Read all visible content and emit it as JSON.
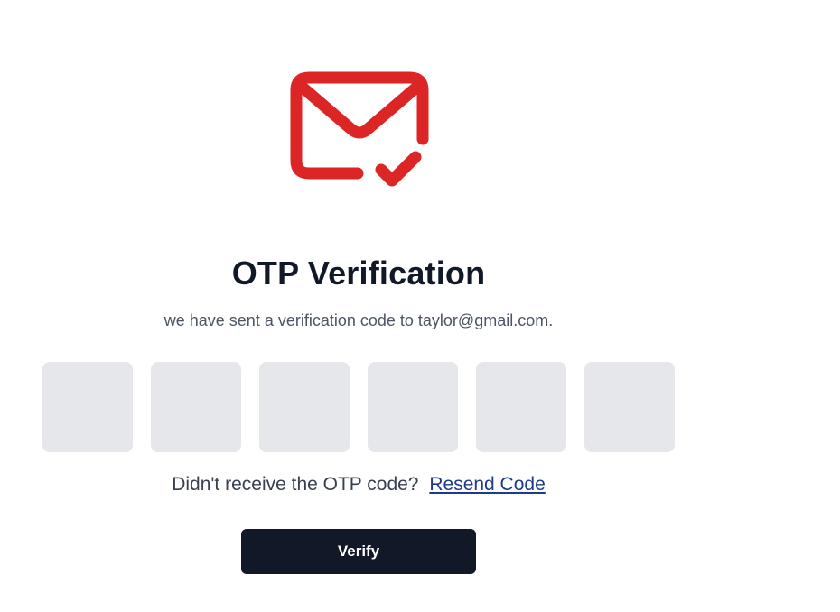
{
  "header": {
    "icon": "mail-check-icon",
    "icon_color": "#dc2626",
    "title": "OTP Verification",
    "subtitle": "we have sent a verification code to taylor@gmail.com."
  },
  "otp": {
    "digits": [
      "",
      "",
      "",
      "",
      "",
      ""
    ],
    "box_color": "#e5e7eb"
  },
  "resend": {
    "prompt": "Didn't receive the OTP code?",
    "link_label": "Resend Code",
    "link_color": "#1e3a8a"
  },
  "actions": {
    "verify_label": "Verify",
    "verify_color": "#111827"
  }
}
